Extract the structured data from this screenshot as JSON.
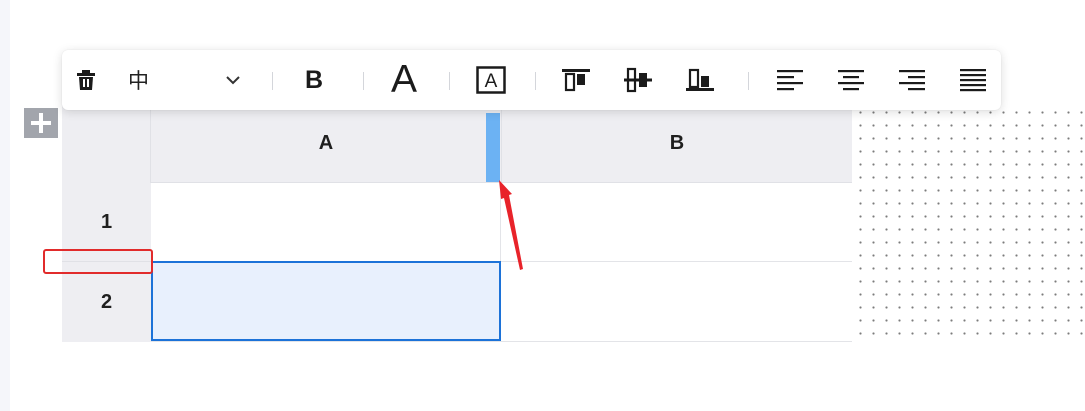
{
  "toolbar": {
    "delete_icon": "trash-icon",
    "font_select": {
      "value": "中",
      "icon": "chevron-down-icon"
    },
    "bold_label": "B",
    "font_size_label": "A",
    "border_text_label": "A",
    "vertical_align_icons": [
      "align-top-icon",
      "align-middle-icon",
      "align-bottom-icon"
    ],
    "horizontal_align_icons": [
      "align-left-icon",
      "align-center-icon",
      "align-right-icon",
      "align-justify-icon"
    ]
  },
  "table": {
    "columns": [
      "A",
      "B"
    ],
    "rows": [
      "1",
      "2"
    ],
    "selected_cell": "A2"
  },
  "add_button_icon": "plus-icon",
  "colors": {
    "header_bg": "#eeeef2",
    "selection_border": "#1c72d8",
    "selection_fill": "#e8f0fd",
    "resizer": "#6cb2f3",
    "annotation": "#e12b2b"
  }
}
